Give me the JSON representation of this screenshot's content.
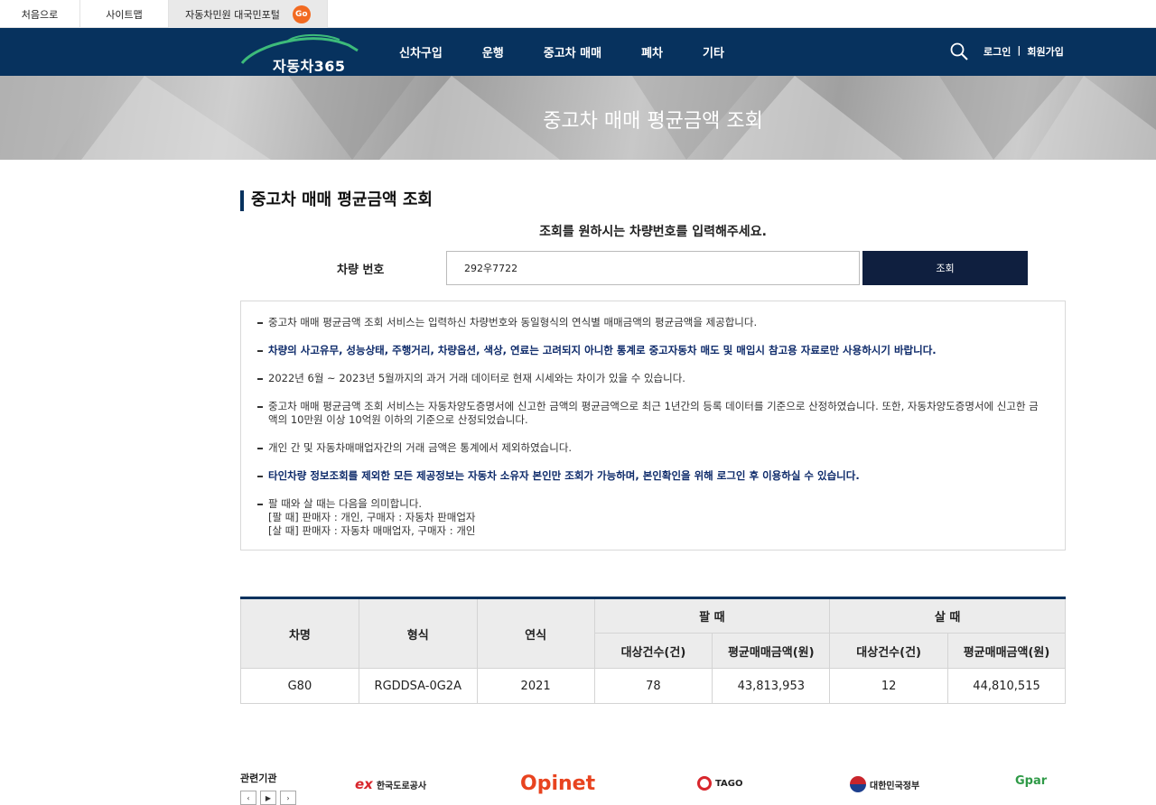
{
  "util": {
    "home": "처음으로",
    "sitemap": "사이트맵",
    "portal": "자동차민원 대국민포털",
    "go": "Go"
  },
  "header": {
    "logo": "자동차365",
    "nav": [
      "신차구입",
      "운행",
      "중고차 매매",
      "폐차",
      "기타"
    ],
    "login": "로그인",
    "separator": "|",
    "signup": "회원가입"
  },
  "banner": {
    "title": "중고차 매매 평균금액 조회"
  },
  "section": {
    "title": "중고차 매매 평균금액 조회",
    "guide": "조회를 원하시는 차량번호를 입력해주세요."
  },
  "search": {
    "label": "차량 번호",
    "value": "292우7722",
    "button": "조회"
  },
  "notice": [
    {
      "text": "중고차 매매 평균금액 조회 서비스는 입력하신 차량번호와 동일형식의 연식별 매매금액의 평균금액을 제공합니다.",
      "emphasis": false
    },
    {
      "text": "차량의 사고유무, 성능상태, 주행거리, 차량옵션, 색상, 연료는 고려되지 아니한 통계로 중고자동차 매도 및 매입시 참고용 자료로만 사용하시기 바랍니다.",
      "emphasis": true
    },
    {
      "text": "2022년 6월 ~ 2023년 5월까지의 과거 거래 데이터로 현재 시세와는 차이가 있을 수 있습니다.",
      "emphasis": false
    },
    {
      "text": "중고차 매매 평균금액 조회 서비스는 자동차양도증명서에 신고한 금액의 평균금액으로 최근 1년간의 등록 데이터를 기준으로 산정하였습니다. 또한, 자동차양도증명서에 신고한 금액의 10만원 이상 10억원 이하의 기준으로 산정되었습니다.",
      "emphasis": false
    },
    {
      "text": "개인 간 및 자동차매매업자간의 거래 금액은 통계에서 제외하였습니다.",
      "emphasis": false
    },
    {
      "text": "타인차량 정보조회를 제외한 모든 제공정보는 자동차 소유자 본인만 조회가 가능하며, 본인확인을 위해 로그인 후 이용하실 수 있습니다.",
      "emphasis": true
    }
  ],
  "notice_last": {
    "line1": "팔 때와 살 때는 다음을 의미합니다.",
    "line2": "[팔 때] 판매자 : 개인, 구매자 : 자동차 판매업자",
    "line3": "[살 때] 판매자 : 자동차 매매업자, 구매자 : 개인"
  },
  "table": {
    "h_name": "차명",
    "h_model": "형식",
    "h_year": "연식",
    "h_sell": "팔 때",
    "h_buy": "살 때",
    "h_count": "대상건수(건)",
    "h_avg": "평균매매금액(원)",
    "row": {
      "name": "G80",
      "model": "RGDDSA-0G2A",
      "year": "2021",
      "sell_count": "78",
      "sell_avg": "43,813,953",
      "buy_count": "12",
      "buy_avg": "44,810,515"
    }
  },
  "footer": {
    "label": "관련기관",
    "prev": "‹",
    "play": "▶",
    "next": "›",
    "ex_mark": "ex",
    "ex_name": "한국도로공사",
    "opinet": "Opinet",
    "tago": "TAGO",
    "gov": "대한민국정부",
    "gpar": "Gpar"
  },
  "colors": {
    "navy": "#07325e",
    "button": "#0f1f3f",
    "emphasis": "#0d2a6a",
    "go_badge": "#f26a21"
  }
}
